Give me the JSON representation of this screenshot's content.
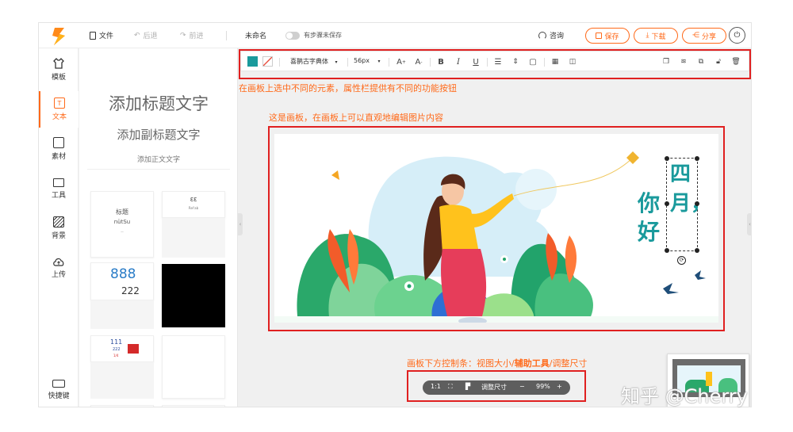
{
  "topbar": {
    "file": "文件",
    "undo": "后退",
    "redo": "前进",
    "doc_name": "未命名",
    "autosave": "有步骤未保存",
    "consult": "咨询",
    "save": "保存",
    "download": "下载",
    "share": "分享"
  },
  "nav": {
    "items": [
      {
        "label": "模板",
        "icon": "shirt-icon"
      },
      {
        "label": "文本",
        "icon": "text-icon"
      },
      {
        "label": "素材",
        "icon": "image-icon"
      },
      {
        "label": "工具",
        "icon": "toolbox-icon"
      },
      {
        "label": "背景",
        "icon": "background-icon"
      },
      {
        "label": "上传",
        "icon": "upload-cloud-icon"
      }
    ],
    "shortcuts": "快捷键"
  },
  "panel": {
    "title": "添加标题文字",
    "subtitle": "添加副标题文字",
    "body": "添加正文文字",
    "templates": [
      {
        "line1": "标题",
        "line2": "nütSu",
        "line3": "··"
      },
      {
        "line1": "ƐƐ",
        "line2": "Rel'ab"
      },
      {
        "line1": "888",
        "line2": "222"
      },
      {
        "line1": "111",
        "line2": "222",
        "line3": "1/4"
      }
    ]
  },
  "toolbar": {
    "fill_color": "#1a9a9c",
    "font_family": "喜鹊古字典体",
    "font_size": "56px",
    "icons": [
      "increase-font-icon",
      "decrease-font-icon",
      "bold-icon",
      "italic-icon",
      "underline-icon",
      "align-icon",
      "line-spacing-icon",
      "text-effect-icon",
      "transparency-icon",
      "flip-icon",
      "copy-icon",
      "layer-icon",
      "group-icon",
      "lock-icon",
      "delete-icon"
    ]
  },
  "notes": {
    "toolbar": "在画板上选中不同的元素，属性栏提供有不同的功能按钮",
    "artboard": "这是画板，在画板上可以直观地编辑图片内容",
    "controls_prefix": "画板下方控制条：视图大小/",
    "controls_bold": "辅助工具",
    "controls_suffix": "/调整尺寸"
  },
  "artboard": {
    "vertical_text": "四月，",
    "side_text": "你好",
    "accent": "#1a9a9c"
  },
  "controls": {
    "ratio": "1:1",
    "resize": "调整尺寸",
    "minus": "−",
    "zoom": "99%",
    "plus": "+"
  },
  "watermark": "知乎 @Cherry",
  "colors": {
    "accent": "#ff6a1a",
    "annotation": "#e02020"
  }
}
